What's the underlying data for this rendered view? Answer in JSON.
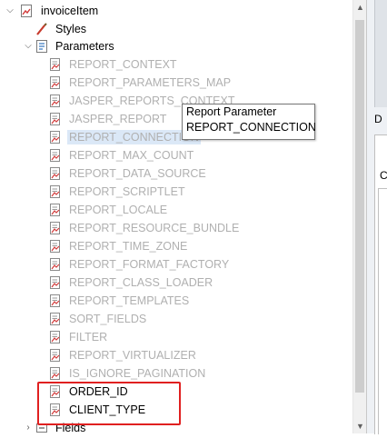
{
  "tree": {
    "root": {
      "label": "invoiceItem"
    },
    "styles": {
      "label": "Styles"
    },
    "parameters": {
      "label": "Parameters",
      "items": [
        {
          "label": "REPORT_CONTEXT",
          "system": true
        },
        {
          "label": "REPORT_PARAMETERS_MAP",
          "system": true
        },
        {
          "label": "JASPER_REPORTS_CONTEXT",
          "system": true
        },
        {
          "label": "JASPER_REPORT",
          "system": true
        },
        {
          "label": "REPORT_CONNECTION",
          "system": true
        },
        {
          "label": "REPORT_MAX_COUNT",
          "system": true
        },
        {
          "label": "REPORT_DATA_SOURCE",
          "system": true
        },
        {
          "label": "REPORT_SCRIPTLET",
          "system": true
        },
        {
          "label": "REPORT_LOCALE",
          "system": true
        },
        {
          "label": "REPORT_RESOURCE_BUNDLE",
          "system": true
        },
        {
          "label": "REPORT_TIME_ZONE",
          "system": true
        },
        {
          "label": "REPORT_FORMAT_FACTORY",
          "system": true
        },
        {
          "label": "REPORT_CLASS_LOADER",
          "system": true
        },
        {
          "label": "REPORT_TEMPLATES",
          "system": true
        },
        {
          "label": "SORT_FIELDS",
          "system": true
        },
        {
          "label": "FILTER",
          "system": true
        },
        {
          "label": "REPORT_VIRTUALIZER",
          "system": true
        },
        {
          "label": "IS_IGNORE_PAGINATION",
          "system": true
        },
        {
          "label": "ORDER_ID",
          "system": false
        },
        {
          "label": "CLIENT_TYPE",
          "system": false
        }
      ]
    },
    "fields": {
      "label": "Fields"
    }
  },
  "tooltip": {
    "title": "Report Parameter",
    "value": "REPORT_CONNECTION"
  },
  "right_panel": {
    "tab_d": "D",
    "tab_c": "C"
  },
  "colors": {
    "system_param_text": "#b0b0b0",
    "highlight_border": "#e02020",
    "selection_bg": "#dbe8f7"
  }
}
